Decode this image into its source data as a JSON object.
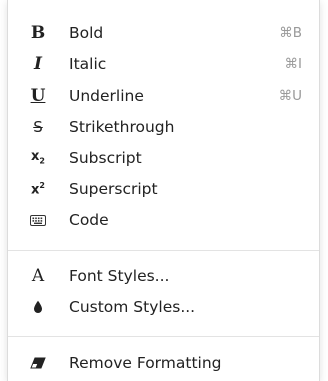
{
  "menu": {
    "items": [
      {
        "label": "Bold",
        "icon": "bold-icon",
        "glyph": "B",
        "shortcut": "⌘B"
      },
      {
        "label": "Italic",
        "icon": "italic-icon",
        "glyph": "I",
        "shortcut": "⌘I"
      },
      {
        "label": "Underline",
        "icon": "underline-icon",
        "glyph": "U",
        "shortcut": "⌘U"
      },
      {
        "label": "Strikethrough",
        "icon": "strikethrough-icon",
        "glyph": "S"
      },
      {
        "label": "Subscript",
        "icon": "subscript-icon",
        "glyph": "x",
        "glyph_mark": "2"
      },
      {
        "label": "Superscript",
        "icon": "superscript-icon",
        "glyph": "x",
        "glyph_mark": "2"
      },
      {
        "label": "Code",
        "icon": "keyboard-icon"
      }
    ],
    "style_items": [
      {
        "label": "Font Styles...",
        "icon": "font-styles-icon",
        "glyph": "A"
      },
      {
        "label": "Custom Styles...",
        "icon": "ink-drop-icon"
      }
    ],
    "footer_items": [
      {
        "label": "Remove Formatting",
        "icon": "eraser-icon"
      }
    ]
  }
}
